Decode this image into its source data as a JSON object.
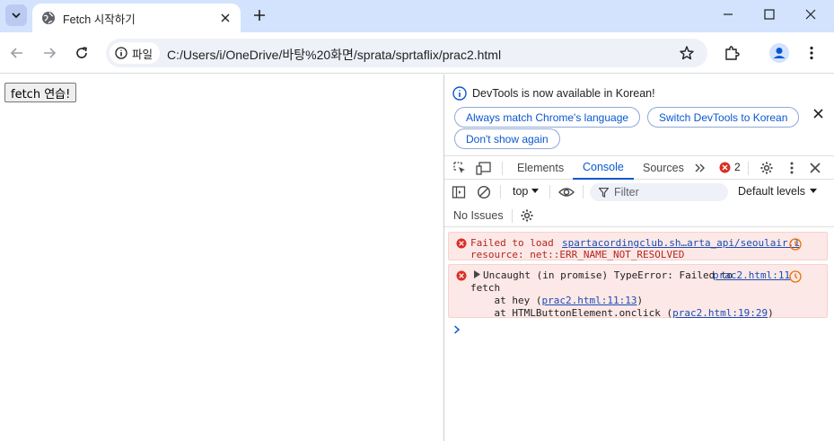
{
  "browser": {
    "tab_title": "Fetch 시작하기",
    "address_chip": "파일",
    "url": "C:/Users/i/OneDrive/바탕%20화면/sprata/sprtaflix/prac2.html"
  },
  "page": {
    "button_label": "fetch 연습!"
  },
  "devtools": {
    "infobar": {
      "message": "DevTools is now available in Korean!",
      "btn_match": "Always match Chrome's language",
      "btn_switch": "Switch DevTools to Korean",
      "btn_dont_show": "Don't show again"
    },
    "tabs": [
      "Elements",
      "Console",
      "Sources"
    ],
    "active_tab": "Console",
    "error_count": "2",
    "context": "top",
    "filter_placeholder": "Filter",
    "levels": "Default levels",
    "issues": "No Issues",
    "messages": [
      {
        "line1": "Failed to load",
        "source": "spartacordingclub.sh…arta_api/seoulair:1",
        "line2": "resource: net::ERR_NAME_NOT_RESOLVED"
      },
      {
        "line1": "Uncaught (in promise) TypeError: Failed to",
        "source": "prac2.html:11",
        "line2": "fetch",
        "stack1_prefix": "    at hey (",
        "stack1_link": "prac2.html:11:13",
        "stack1_suffix": ")",
        "stack2_prefix": "    at HTMLButtonElement.onclick (",
        "stack2_link": "prac2.html:19:29",
        "stack2_suffix": ")"
      }
    ]
  },
  "colors": {
    "tabstrip": "#d3e3fd",
    "accent": "#0b57d0",
    "error": "#d93025",
    "error_bg": "#fce8e6"
  }
}
